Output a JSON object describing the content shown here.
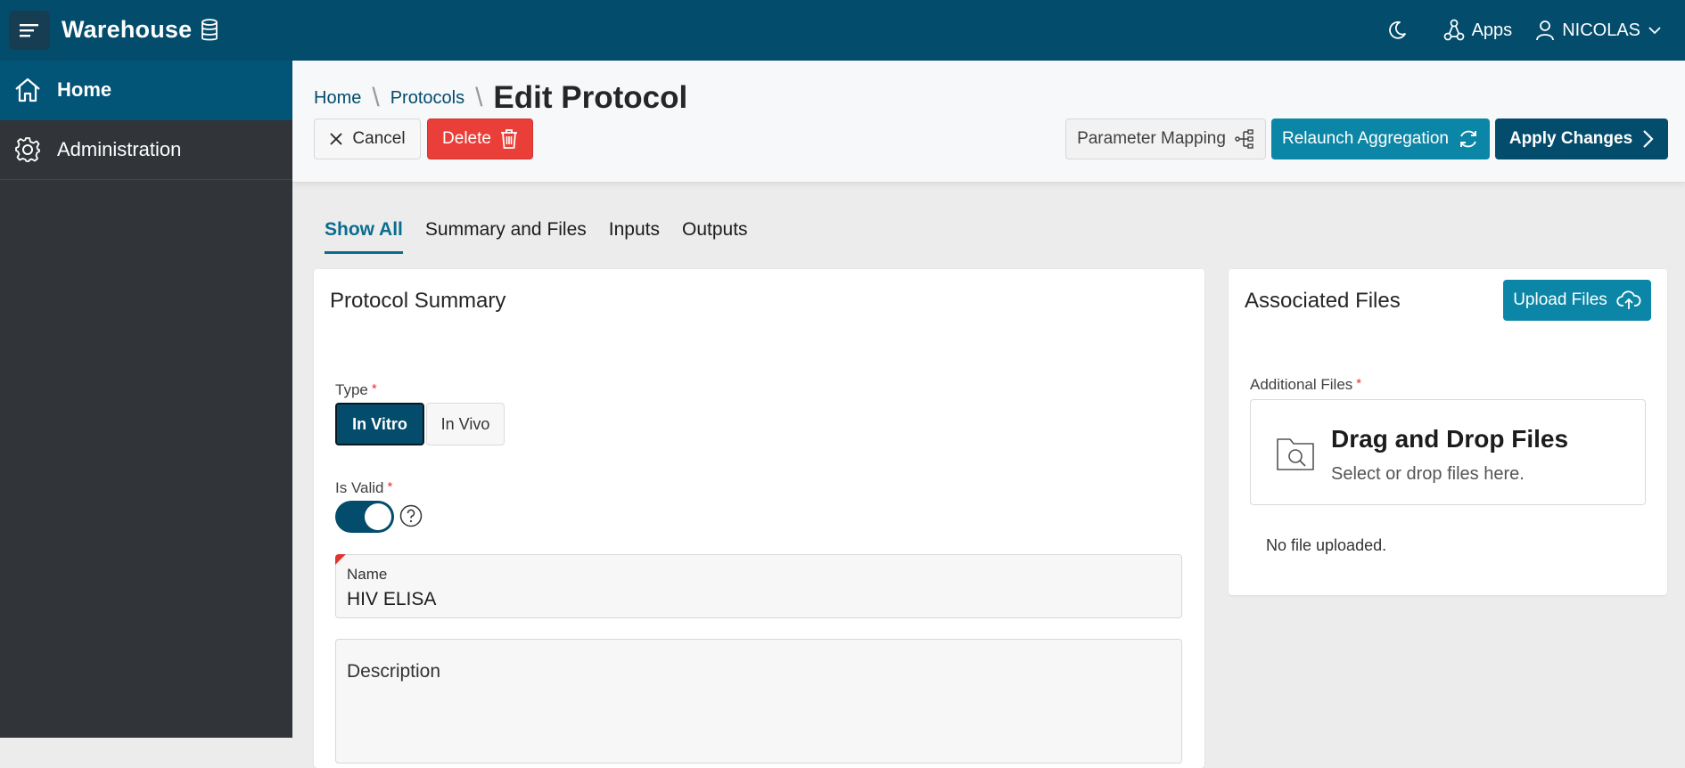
{
  "topbar": {
    "app_title": "Warehouse",
    "apps_label": "Apps",
    "user_label": "NICOLAS"
  },
  "sidebar": {
    "items": [
      {
        "label": "Home",
        "icon": "home-icon",
        "active": true
      },
      {
        "label": "Administration",
        "icon": "gear-icon",
        "active": false
      }
    ]
  },
  "breadcrumb": {
    "items": [
      "Home",
      "Protocols"
    ],
    "current": "Edit Protocol"
  },
  "toolbar": {
    "cancel_label": "Cancel",
    "delete_label": "Delete",
    "param_mapping_label": "Parameter Mapping",
    "relaunch_label": "Relaunch Aggregation",
    "apply_label": "Apply Changes"
  },
  "tabs": [
    {
      "label": "Show All",
      "active": true
    },
    {
      "label": "Summary and Files",
      "active": false
    },
    {
      "label": "Inputs",
      "active": false
    },
    {
      "label": "Outputs",
      "active": false
    }
  ],
  "summary": {
    "title": "Protocol Summary",
    "type_label": "Type",
    "type_options": [
      "In Vitro",
      "In Vivo"
    ],
    "type_selected": "In Vitro",
    "is_valid_label": "Is Valid",
    "is_valid_on": true,
    "name_label": "Name",
    "name_value": "HIV ELISA",
    "description_label": "Description",
    "required_mark": "*"
  },
  "files": {
    "title": "Associated Files",
    "upload_label": "Upload Files",
    "additional_label": "Additional Files",
    "drop_title": "Drag and Drop Files",
    "drop_subtitle": "Select or drop files here.",
    "no_file": "No file uploaded."
  },
  "colors": {
    "brand": "#034c6c",
    "accent": "#0c86a6",
    "danger": "#ea3f38",
    "sidebar": "#313438"
  }
}
